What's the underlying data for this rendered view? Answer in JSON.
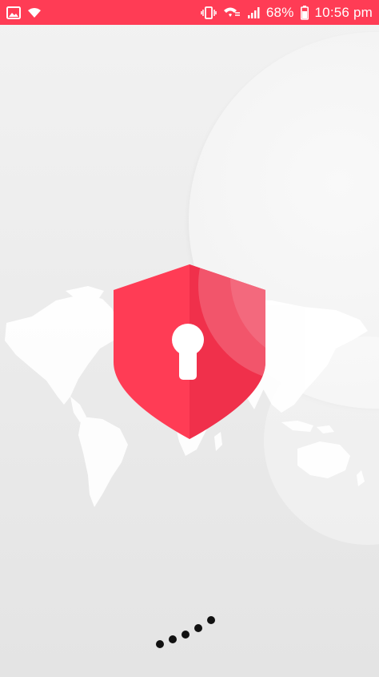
{
  "status_bar": {
    "battery_percent": "68%",
    "time": "10:56 pm",
    "icons": [
      "image-icon",
      "wifi-icon",
      "vibrate-icon",
      "wifi-call-icon",
      "signal-icon",
      "battery-icon"
    ]
  },
  "splash": {
    "logo_icon": "shield-keyhole-icon",
    "background_icon": "world-map-icon",
    "loading_indicator": "loading-dots-icon"
  },
  "colors": {
    "accent": "#ff3c55",
    "accent_dark": "#ec2a45",
    "keyhole": "#ffffff",
    "background": "#ececec"
  }
}
